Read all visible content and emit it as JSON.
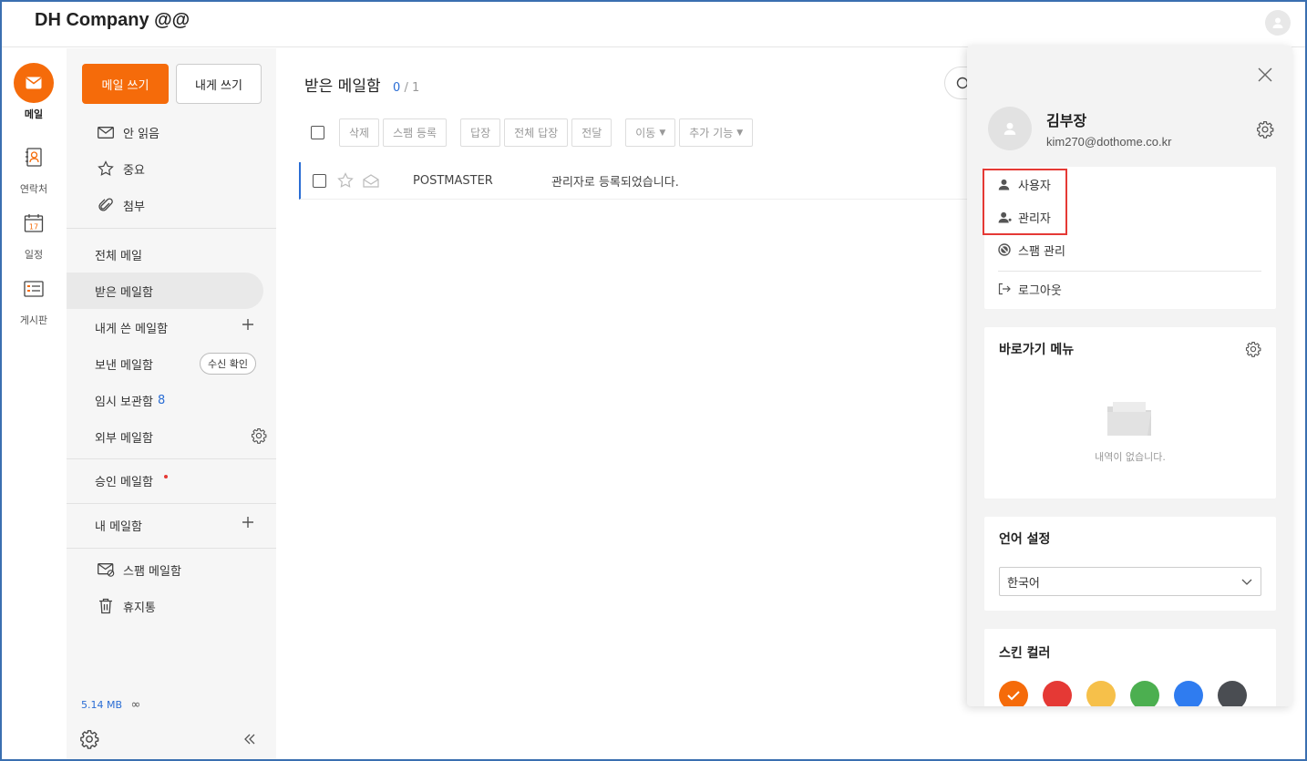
{
  "header": {
    "brand": "DH Company @@"
  },
  "rail": {
    "items": [
      {
        "label": "메일"
      },
      {
        "label": "연락처"
      },
      {
        "label": "일정"
      },
      {
        "label": "게시판"
      }
    ],
    "calendar_day": "17"
  },
  "sidebar": {
    "compose_label": "메일 쓰기",
    "self_label": "내게 쓰기",
    "quick": [
      {
        "label": "안 읽음",
        "icon": "envelope-icon"
      },
      {
        "label": "중요",
        "icon": "star-icon"
      },
      {
        "label": "첨부",
        "icon": "paperclip-icon"
      }
    ],
    "folders": {
      "all": "전체 메일",
      "inbox": "받은 메일함",
      "self": "내게 쓴 메일함",
      "sent": "보낸 메일함",
      "sent_badge": "수신 확인",
      "drafts": "임시 보관함",
      "drafts_count": "8",
      "external": "외부 메일함",
      "approval": "승인 메일함",
      "mine": "내 메일함",
      "spam": "스팸 메일함",
      "trash": "휴지통"
    },
    "storage": {
      "used": "5.14 MB",
      "limit": "∞"
    }
  },
  "main": {
    "title": "받은 메일함",
    "count_unread": "0",
    "count_total": "/ 1",
    "toolbar": {
      "delete": "삭제",
      "spam": "스팸 등록",
      "reply": "답장",
      "reply_all": "전체 답장",
      "forward": "전달",
      "move": "이동",
      "more": "추가 기능"
    },
    "messages": [
      {
        "sender": "POSTMASTER",
        "subject": "관리자로 등록되었습니다."
      }
    ]
  },
  "panel": {
    "name": "김부장",
    "email": "kim270@dothome.co.kr",
    "menu": {
      "user": "사용자",
      "admin": "관리자",
      "spam": "스팸 관리",
      "logout": "로그아웃"
    },
    "shortcut": {
      "title": "바로가기 메뉴",
      "empty": "내역이 없습니다."
    },
    "language": {
      "title": "언어 설정",
      "selected": "한국어"
    },
    "skin": {
      "title": "스킨 컬러",
      "colors": [
        "#f56b0a",
        "#e53935",
        "#f6c04a",
        "#4caf50",
        "#2f7cf0",
        "#4a4d52"
      ]
    }
  }
}
